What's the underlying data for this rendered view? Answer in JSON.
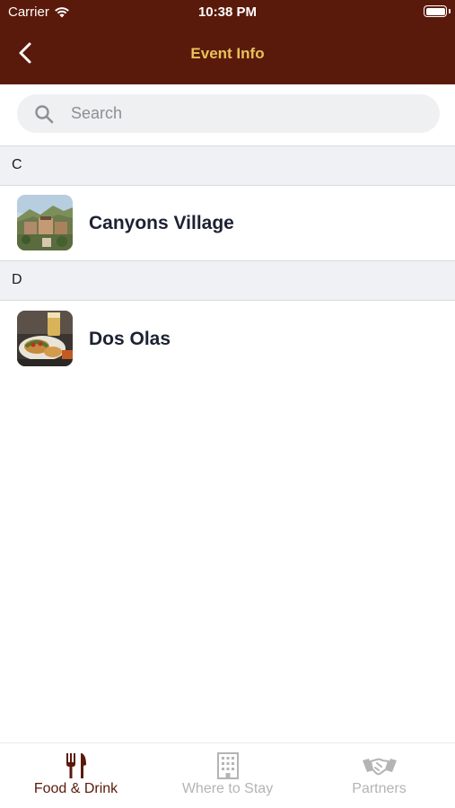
{
  "status_bar": {
    "carrier": "Carrier",
    "time": "10:38 PM"
  },
  "nav": {
    "title": "Event Info",
    "back_icon": "chevron-left-icon"
  },
  "search": {
    "placeholder": "Search",
    "value": ""
  },
  "sections": [
    {
      "letter": "C",
      "items": [
        {
          "label": "Canyons Village",
          "thumbnail": "canyons-village-photo"
        }
      ]
    },
    {
      "letter": "D",
      "items": [
        {
          "label": "Dos Olas",
          "thumbnail": "dos-olas-photo"
        }
      ]
    }
  ],
  "tabs": [
    {
      "label": "Food & Drink",
      "icon": "utensils-icon",
      "active": true
    },
    {
      "label": "Where to Stay",
      "icon": "building-icon",
      "active": false
    },
    {
      "label": "Partners",
      "icon": "handshake-icon",
      "active": false
    }
  ],
  "colors": {
    "header_bg": "#5a1a0b",
    "title": "#e9c25a",
    "tab_active": "#5a1a0b",
    "tab_inactive": "#b4b4b6"
  }
}
